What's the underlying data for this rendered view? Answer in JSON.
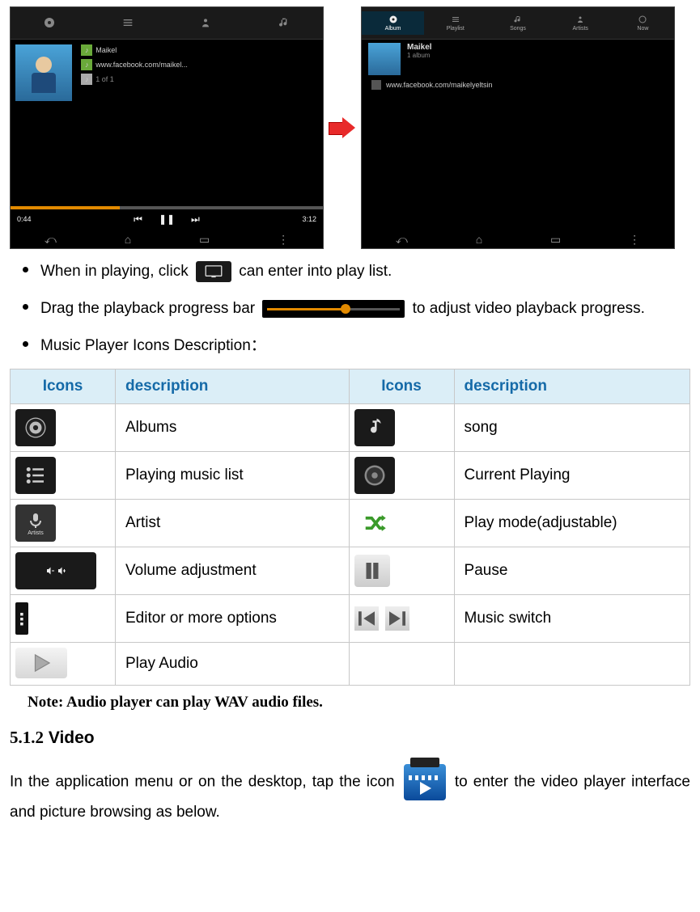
{
  "bullets": {
    "b1_pre": "When in playing, click ",
    "b1_post": " can enter into play list.",
    "b2_pre": "Drag  the  playback  progress  bar ",
    "b2_post": " to  adjust  video  playback progress.",
    "b3": "Music Player Icons Description："
  },
  "table": {
    "h1": "Icons",
    "h2": "description",
    "h3": "Icons",
    "h4": "description",
    "rows": [
      {
        "d1": "Albums",
        "d2": "song"
      },
      {
        "d1": "Playing music list",
        "d2": "Current Playing"
      },
      {
        "d1": "Artist",
        "d2": "Play mode(adjustable)"
      },
      {
        "d1": "Volume adjustment",
        "d2": "Pause"
      },
      {
        "d1": "Editor or more options",
        "d2": "Music switch"
      },
      {
        "d1": "Play Audio",
        "d2": ""
      }
    ]
  },
  "note": "Note: Audio player can play WAV audio files.",
  "section": {
    "num": "5.1.2",
    "title": " Video"
  },
  "body": {
    "pre": "In the application menu or on the desktop, tap the icon ",
    "post": " to enter the video player interface and picture browsing as below."
  }
}
